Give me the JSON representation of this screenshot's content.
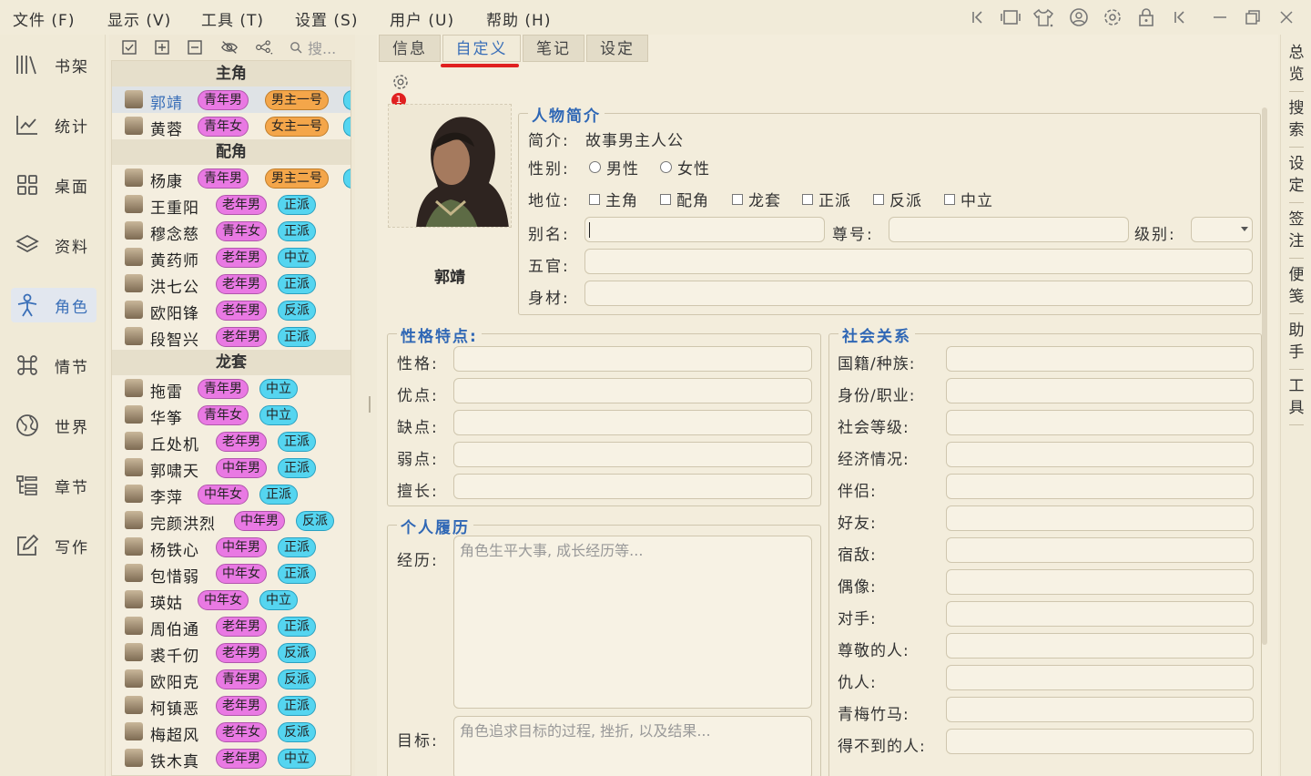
{
  "menubar": {
    "items": [
      "文件 (F)",
      "显示 (V)",
      "工具 (T)",
      "设置 (S)",
      "用户 (U)",
      "帮助 (H)"
    ]
  },
  "titlebar_icons": [
    "collapse-left-icon",
    "book-view-icon",
    "theme-shirt-icon",
    "user-circle-icon",
    "settings-gear-icon",
    "lock-icon",
    "collapse-icon",
    "minimize-icon",
    "maximize-icon",
    "close-icon"
  ],
  "leftnav": {
    "items": [
      {
        "label": "书架",
        "icon": "bookshelf-icon"
      },
      {
        "label": "统计",
        "icon": "chart-line-icon"
      },
      {
        "label": "桌面",
        "icon": "grid-icon"
      },
      {
        "label": "资料",
        "icon": "layers-icon"
      },
      {
        "label": "角色",
        "icon": "person-icon",
        "active": true
      },
      {
        "label": "情节",
        "icon": "command-icon"
      },
      {
        "label": "世界",
        "icon": "globe-icon"
      },
      {
        "label": "章节",
        "icon": "list-tree-icon"
      },
      {
        "label": "写作",
        "icon": "edit-icon"
      }
    ]
  },
  "charpanel": {
    "search_placeholder": "搜...",
    "groups": [
      {
        "title": "主角",
        "rows": [
          {
            "name": "郭靖",
            "age": "青年男",
            "role": "男主一号",
            "extra": true,
            "selected": true
          },
          {
            "name": "黄蓉",
            "age": "青年女",
            "role": "女主一号",
            "extra": true
          }
        ]
      },
      {
        "title": "配角",
        "rows": [
          {
            "name": "杨康",
            "age": "青年男",
            "role": "男主二号",
            "extra": true
          },
          {
            "name": "王重阳",
            "age": "老年男",
            "faction": "正派"
          },
          {
            "name": "穆念慈",
            "age": "青年女",
            "faction": "正派"
          },
          {
            "name": "黄药师",
            "age": "老年男",
            "faction": "中立"
          },
          {
            "name": "洪七公",
            "age": "老年男",
            "faction": "正派"
          },
          {
            "name": "欧阳锋",
            "age": "老年男",
            "faction": "反派"
          },
          {
            "name": "段智兴",
            "age": "老年男",
            "faction": "正派"
          }
        ]
      },
      {
        "title": "龙套",
        "rows": [
          {
            "name": "拖雷",
            "age": "青年男",
            "faction": "中立"
          },
          {
            "name": "华筝",
            "age": "青年女",
            "faction": "中立"
          },
          {
            "name": "丘处机",
            "age": "老年男",
            "faction": "正派"
          },
          {
            "name": "郭啸天",
            "age": "中年男",
            "faction": "正派"
          },
          {
            "name": "李萍",
            "age": "中年女",
            "faction": "正派"
          },
          {
            "name": "完颜洪烈",
            "age": "中年男",
            "faction": "反派"
          },
          {
            "name": "杨铁心",
            "age": "中年男",
            "faction": "正派"
          },
          {
            "name": "包惜弱",
            "age": "中年女",
            "faction": "正派"
          },
          {
            "name": "瑛姑",
            "age": "中年女",
            "faction": "中立"
          },
          {
            "name": "周伯通",
            "age": "老年男",
            "faction": "正派"
          },
          {
            "name": "裘千仞",
            "age": "老年男",
            "faction": "反派"
          },
          {
            "name": "欧阳克",
            "age": "青年男",
            "faction": "反派"
          },
          {
            "name": "柯镇恶",
            "age": "老年男",
            "faction": "正派"
          },
          {
            "name": "梅超风",
            "age": "老年女",
            "faction": "反派"
          },
          {
            "name": "铁木真",
            "age": "老年男",
            "faction": "中立"
          }
        ]
      }
    ]
  },
  "tabs": [
    "信息",
    "自定义",
    "笔记",
    "设定"
  ],
  "active_tab": "自定义",
  "badge_count": "1",
  "character": {
    "name": "郭靖"
  },
  "profile": {
    "legend": "人物简介",
    "intro_label": "简介:",
    "intro_value": "故事男主人公",
    "gender_label": "性别:",
    "gender_options": [
      "男性",
      "女性"
    ],
    "status_label": "地位:",
    "status_options": [
      "主角",
      "配角",
      "龙套",
      "正派",
      "反派",
      "中立"
    ],
    "alias_label": "别名:",
    "title_label": "尊号:",
    "level_label": "级别:",
    "features_label": "五官:",
    "body_label": "身材:"
  },
  "personality": {
    "legend": "性格特点:",
    "fields": [
      "性格:",
      "优点:",
      "缺点:",
      "弱点:",
      "擅长:"
    ]
  },
  "history": {
    "legend": "个人履历",
    "experience_label": "经历:",
    "experience_placeholder": "角色生平大事, 成长经历等...",
    "goal_label": "目标:",
    "goal_placeholder": "角色追求目标的过程, 挫折, 以及结果..."
  },
  "social": {
    "legend": "社会关系",
    "fields": [
      "国籍/种族:",
      "身份/职业:",
      "社会等级:",
      "经济情况:",
      "伴侣:",
      "好友:",
      "宿敌:",
      "偶像:",
      "对手:",
      "尊敬的人:",
      "仇人:",
      "青梅竹马:",
      "得不到的人:"
    ]
  },
  "rightnav": {
    "items": [
      "总览",
      "搜索",
      "设定",
      "签注",
      "便笺",
      "助手",
      "工具"
    ]
  },
  "colors": {
    "accent": "#2f67b5",
    "age_pill": "#e979e3",
    "role_pill": "#f4a64a",
    "faction_pill": "#55d5f0",
    "tab_underline": "#e02020"
  }
}
